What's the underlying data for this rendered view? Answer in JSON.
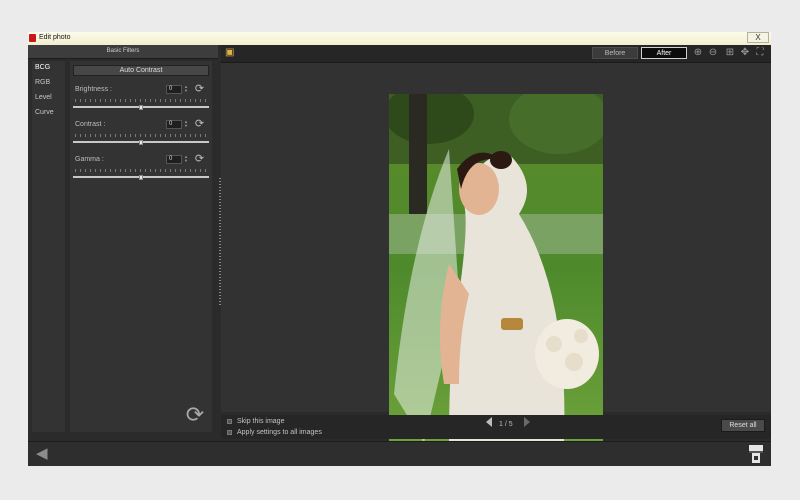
{
  "window": {
    "title": "Edit photo",
    "close_label": "X"
  },
  "left_panel": {
    "header": "Basic Filters",
    "tabs": [
      "BCG",
      "RGB",
      "Level",
      "Curve"
    ],
    "active_tab": "BCG",
    "auto_contrast_label": "Auto Contrast",
    "filters": [
      {
        "label": "Brightness :",
        "value": "0",
        "level": 0.5
      },
      {
        "label": "Contrast :",
        "value": "0",
        "level": 0.5
      },
      {
        "label": "Gamma :",
        "value": "0",
        "level": 0.5
      }
    ]
  },
  "toolbar": {
    "before_label": "Before",
    "after_label": "After",
    "selected": "After",
    "icons": [
      "zoom-in-icon",
      "zoom-out-icon",
      "fit-icon",
      "pan-icon",
      "fullscreen-icon"
    ]
  },
  "bottom": {
    "skip_label": "Skip this image",
    "apply_all_label": "Apply settings to all images",
    "page_indicator": "1 / 5",
    "reset_all_label": "Reset all"
  },
  "colors": {
    "accent": "#e2b04a",
    "panel": "#333333",
    "app_icon": "#c81818"
  }
}
